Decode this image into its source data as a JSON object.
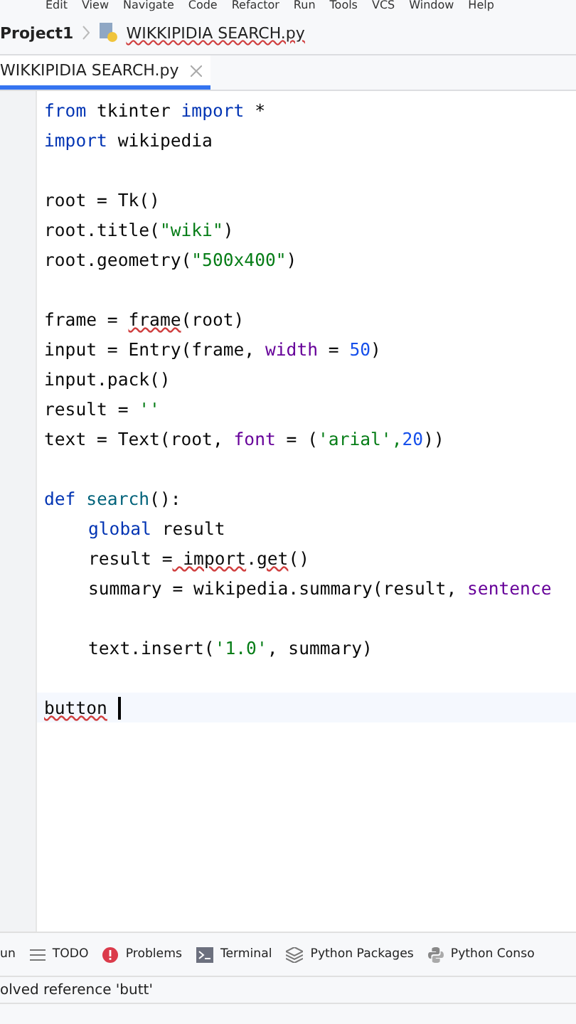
{
  "menu": [
    "Edit",
    "View",
    "Navigate",
    "Code",
    "Refactor",
    "Run",
    "Tools",
    "VCS",
    "Window",
    "Help"
  ],
  "breadcrumbs": [
    {
      "label": "Project1",
      "kind": "project"
    },
    {
      "label": "WIKKIPIDIA SEARCH.py",
      "kind": "file"
    }
  ],
  "tabs": [
    {
      "label": "WIKKIPIDIA SEARCH.py",
      "selected": true
    }
  ],
  "code_lines": [
    {
      "kind": "code",
      "segments": [
        {
          "text": "from",
          "kind": "keyword"
        },
        {
          "text": " tkinter ",
          "kind": "plain"
        },
        {
          "text": "import",
          "kind": "keyword"
        },
        {
          "text": " *",
          "kind": "plain"
        }
      ]
    },
    {
      "kind": "code",
      "segments": [
        {
          "text": "import",
          "kind": "keyword"
        },
        {
          "text": " wikipedia",
          "kind": "plain"
        }
      ]
    },
    {
      "kind": "blank"
    },
    {
      "kind": "code",
      "segments": [
        {
          "text": "root = Tk()",
          "kind": "plain"
        }
      ]
    },
    {
      "kind": "code",
      "segments": [
        {
          "text": "root.title(",
          "kind": "plain"
        },
        {
          "text": "\"wiki\"",
          "kind": "string"
        },
        {
          "text": ")",
          "kind": "plain"
        }
      ]
    },
    {
      "kind": "code",
      "segments": [
        {
          "text": "root.geometry(",
          "kind": "plain"
        },
        {
          "text": "\"500x400\"",
          "kind": "string"
        },
        {
          "text": ")",
          "kind": "plain"
        }
      ]
    },
    {
      "kind": "blank"
    },
    {
      "kind": "code",
      "segments": [
        {
          "text": "frame = ",
          "kind": "plain"
        },
        {
          "text": "frame",
          "kind": "error"
        },
        {
          "text": "(root)",
          "kind": "plain"
        }
      ]
    },
    {
      "kind": "code",
      "segments": [
        {
          "text": "input = Entry(frame, ",
          "kind": "plain"
        },
        {
          "text": "width",
          "kind": "param"
        },
        {
          "text": " = ",
          "kind": "plain"
        },
        {
          "text": "50",
          "kind": "number"
        },
        {
          "text": ")",
          "kind": "plain"
        }
      ]
    },
    {
      "kind": "code",
      "segments": [
        {
          "text": "input.pack()",
          "kind": "plain"
        }
      ]
    },
    {
      "kind": "code",
      "segments": [
        {
          "text": "result = ",
          "kind": "plain"
        },
        {
          "text": "''",
          "kind": "string"
        }
      ]
    },
    {
      "kind": "code",
      "segments": [
        {
          "text": "text = Text(root, ",
          "kind": "plain"
        },
        {
          "text": "font",
          "kind": "param"
        },
        {
          "text": " = (",
          "kind": "plain"
        },
        {
          "text": "'arial',",
          "kind": "string"
        },
        {
          "text": "20",
          "kind": "number"
        },
        {
          "text": "))",
          "kind": "plain"
        }
      ]
    },
    {
      "kind": "blank"
    },
    {
      "kind": "code",
      "segments": [
        {
          "text": "def ",
          "kind": "keyword"
        },
        {
          "text": "search",
          "kind": "function"
        },
        {
          "text": "():",
          "kind": "plain"
        }
      ]
    },
    {
      "kind": "code",
      "indented": true,
      "segments": [
        {
          "text": "global",
          "kind": "keyword"
        },
        {
          "text": " result",
          "kind": "plain"
        }
      ]
    },
    {
      "kind": "code",
      "indented": true,
      "segments": [
        {
          "text": "result =",
          "kind": "plain"
        },
        {
          "text": " import",
          "kind": "error"
        },
        {
          "text": ".",
          "kind": "plain"
        },
        {
          "text": "get",
          "kind": "error"
        },
        {
          "text": "()",
          "kind": "plain"
        }
      ]
    },
    {
      "kind": "code",
      "indented": true,
      "segments": [
        {
          "text": "summary = wikipedia.summary(result, ",
          "kind": "plain"
        },
        {
          "text": "sentence",
          "kind": "param"
        }
      ]
    },
    {
      "kind": "blank"
    },
    {
      "kind": "code",
      "indented": true,
      "segments": [
        {
          "text": "text.insert(",
          "kind": "plain"
        },
        {
          "text": "'1.0'",
          "kind": "string"
        },
        {
          "text": ", summary)",
          "kind": "plain"
        }
      ]
    },
    {
      "kind": "blank"
    },
    {
      "kind": "code",
      "current": true,
      "segments": [
        {
          "text": "button",
          "kind": "error"
        }
      ]
    }
  ],
  "tool_windows": [
    {
      "label": "un",
      "kind": "run"
    },
    {
      "label": "TODO",
      "kind": "todo"
    },
    {
      "label": "Problems",
      "kind": "problems"
    },
    {
      "label": "Terminal",
      "kind": "terminal"
    },
    {
      "label": "Python Packages",
      "kind": "packages"
    },
    {
      "label": "Python Conso",
      "kind": "console"
    }
  ],
  "status_message": "olved reference 'butt'"
}
